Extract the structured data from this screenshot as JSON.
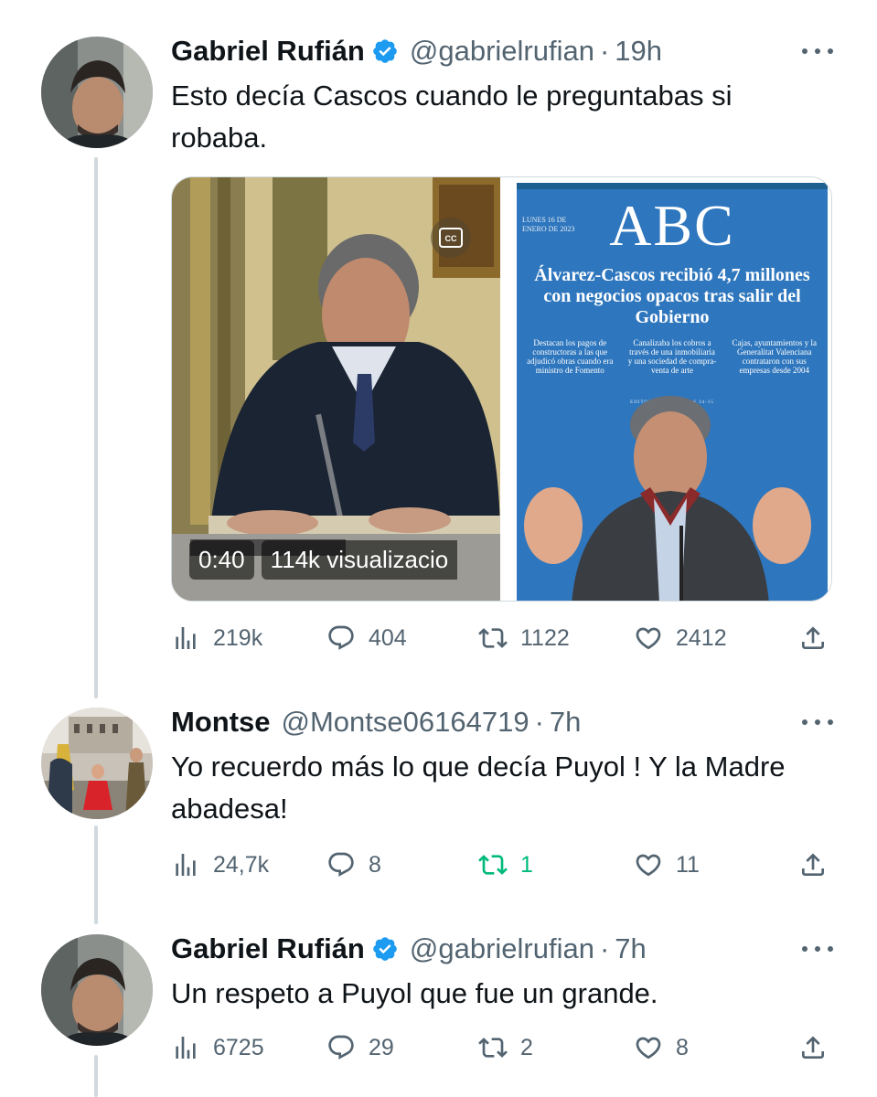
{
  "tweets": [
    {
      "name": "Gabriel Rufián",
      "verified": true,
      "handle": "@gabrielrufian",
      "separator": "·",
      "time": "19h",
      "text": "Esto decía Cascos cuando le preguntabas si robaba.",
      "media": {
        "video_duration": "0:40",
        "video_views": "114k visualizacio",
        "newspaper": {
          "logo": "ABC",
          "date": "LUNES 16 DE ENERO DE 2023",
          "headline": "Álvarez-Cascos recibió 4,7 millones con negocios opacos tras salir del Gobierno",
          "columns": [
            "Destacan los pagos de constructoras a las que adjudicó obras cuando era ministro de Fomento",
            "Canalizaba los cobros a través de una inmobiliaria y una sociedad de compra-venta de arte",
            "Cajas, ayuntamientos y la Generalitat Valenciana contrataron con sus empresas desde 2004"
          ],
          "credit": "EDITORIAL Y PÁGINAS 34-35"
        }
      },
      "stats": {
        "views": "219k",
        "replies": "404",
        "retweets": "1122",
        "likes": "2412"
      }
    },
    {
      "name": "Montse",
      "verified": false,
      "handle": "@Montse06164719",
      "separator": "·",
      "time": "7h",
      "text": "Yo recuerdo más lo que decía Puyol ! Y la Madre abadesa!",
      "stats": {
        "views": "24,7k",
        "replies": "8",
        "retweets": "1",
        "likes": "11"
      },
      "retweeted": true
    },
    {
      "name": "Gabriel Rufián",
      "verified": true,
      "handle": "@gabrielrufian",
      "separator": "·",
      "time": "7h",
      "text": "Un respeto a Puyol que fue un grande.",
      "stats": {
        "views": "6725",
        "replies": "29",
        "retweets": "2",
        "likes": "8"
      }
    }
  ],
  "colors": {
    "text": "#0f1419",
    "secondary": "#536471",
    "verified": "#1d9bf0",
    "retweet_active": "#00ba7c",
    "thread_line": "#cfd9de"
  }
}
